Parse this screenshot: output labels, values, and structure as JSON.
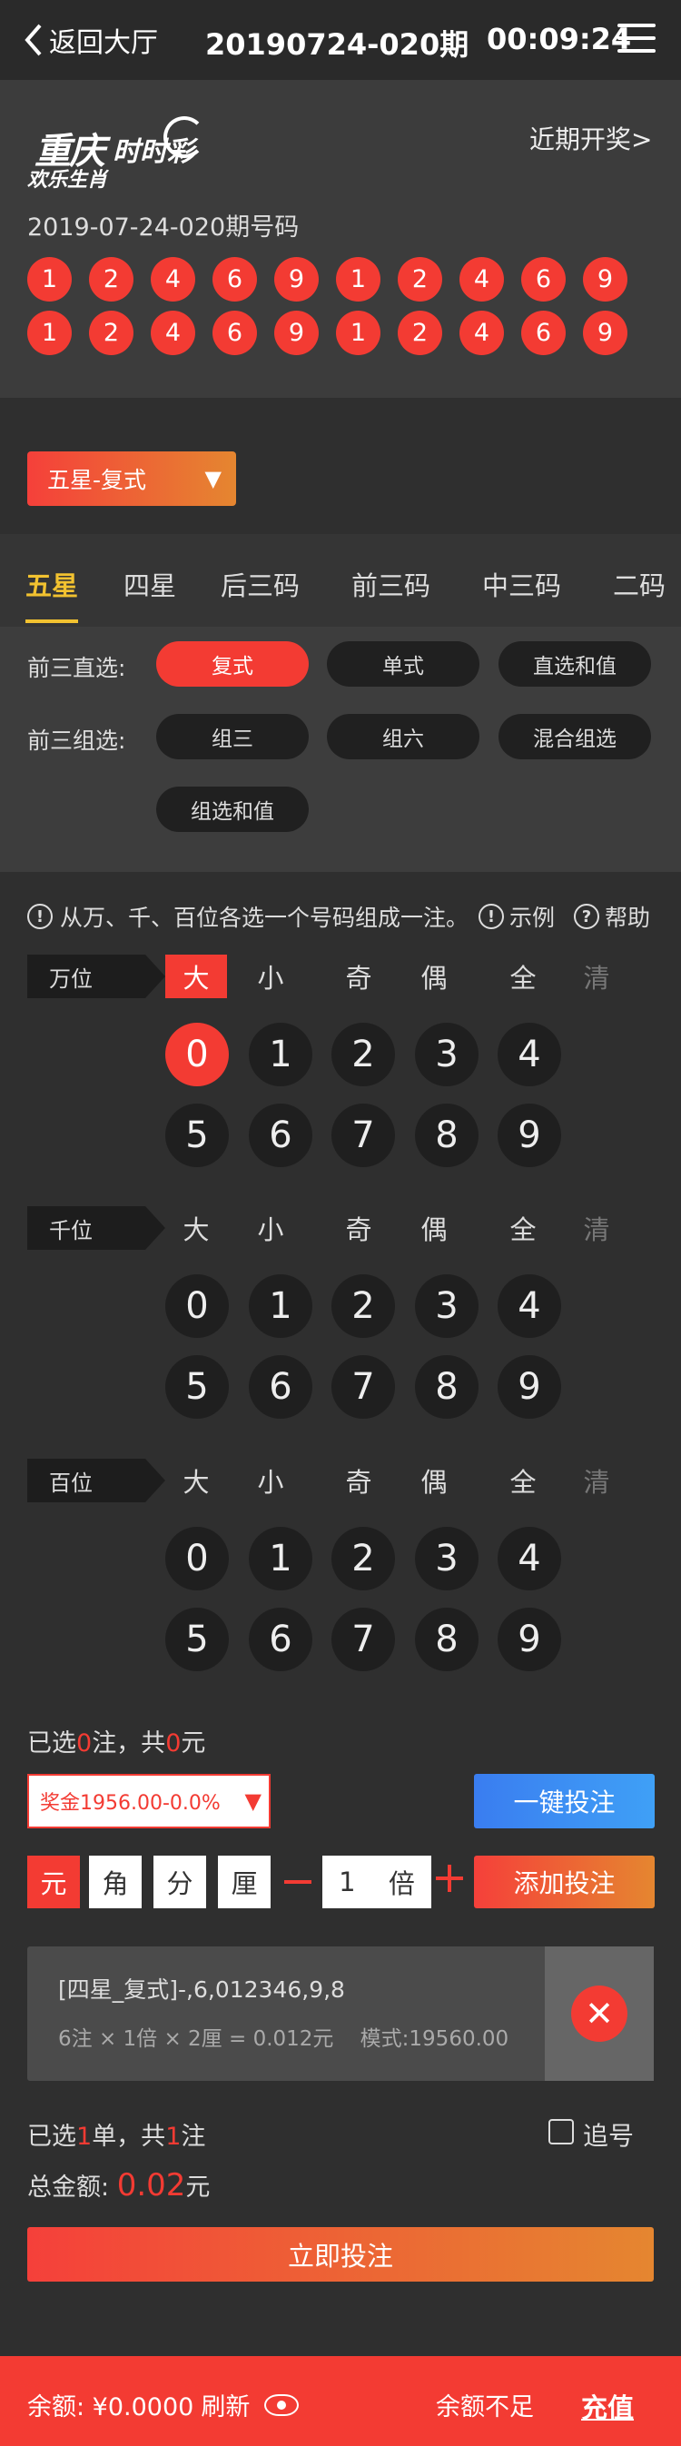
{
  "topbar": {
    "back_label": "返回大厅",
    "title": "20190724-020期",
    "timer": "00:09:24"
  },
  "hero": {
    "logo": {
      "line1": "重庆",
      "line2": "时时彩",
      "line3": "欢乐生肖"
    },
    "recent_label": "近期开奖>",
    "issue_label": "2019-07-24-020期号码",
    "row1": [
      "1",
      "2",
      "4",
      "6",
      "9",
      "1",
      "2",
      "4",
      "6",
      "9"
    ],
    "row2": [
      "1",
      "2",
      "4",
      "6",
      "9",
      "1",
      "2",
      "4",
      "6",
      "9"
    ]
  },
  "mode_dropdown": "五星-复式",
  "tabs": [
    "五星",
    "四星",
    "后三码",
    "前三码",
    "中三码",
    "二码"
  ],
  "direct": {
    "label": "前三直选:",
    "options": [
      "复式",
      "单式",
      "直选和值"
    ]
  },
  "group": {
    "label": "前三组选:",
    "options": [
      "组三",
      "组六",
      "混合组选",
      "组选和值"
    ]
  },
  "tip": {
    "text": "从万、千、百位各选一个号码组成一注。",
    "example": "示例",
    "help": "帮助"
  },
  "filters": [
    "大",
    "小",
    "奇",
    "偶",
    "全",
    "清"
  ],
  "positions": [
    {
      "name": "万位",
      "digits": [
        "0",
        "1",
        "2",
        "3",
        "4",
        "5",
        "6",
        "7",
        "8",
        "9"
      ]
    },
    {
      "name": "千位",
      "digits": [
        "0",
        "1",
        "2",
        "3",
        "4",
        "5",
        "6",
        "7",
        "8",
        "9"
      ]
    },
    {
      "name": "百位",
      "digits": [
        "0",
        "1",
        "2",
        "3",
        "4",
        "5",
        "6",
        "7",
        "8",
        "9"
      ]
    }
  ],
  "summary": {
    "prefix": "已选",
    "count": "0",
    "mid": "注，共",
    "amount": "0",
    "suffix": "元"
  },
  "bonus": "奖金1956.00-0.0%",
  "one_key_bet": "一键投注",
  "units": [
    "元",
    "角",
    "分",
    "厘"
  ],
  "multiplier": {
    "value": "1",
    "label": "倍"
  },
  "add_bet": "添加投注",
  "bet_item": {
    "line1": "[四星_复式]-,6,012346,9,8",
    "line2": "6注 × 1倍 × 2厘 = 0.012元    模式:19560.00"
  },
  "selected": {
    "prefix": "已选",
    "orders": "1",
    "mid": "单，共",
    "bets": "1",
    "suffix": "注"
  },
  "chase_label": "追号",
  "total": {
    "label": "总金额:",
    "amount": "0.02",
    "unit": "元"
  },
  "bet_now": "立即投注",
  "footer": {
    "balance": "余额: ¥0.0000",
    "refresh": "刷新",
    "insufficient": "余额不足",
    "recharge": "充值"
  },
  "colors": {
    "accent": "#f33b33",
    "tab_active": "#f2c230",
    "background": "#2f2f2f"
  }
}
